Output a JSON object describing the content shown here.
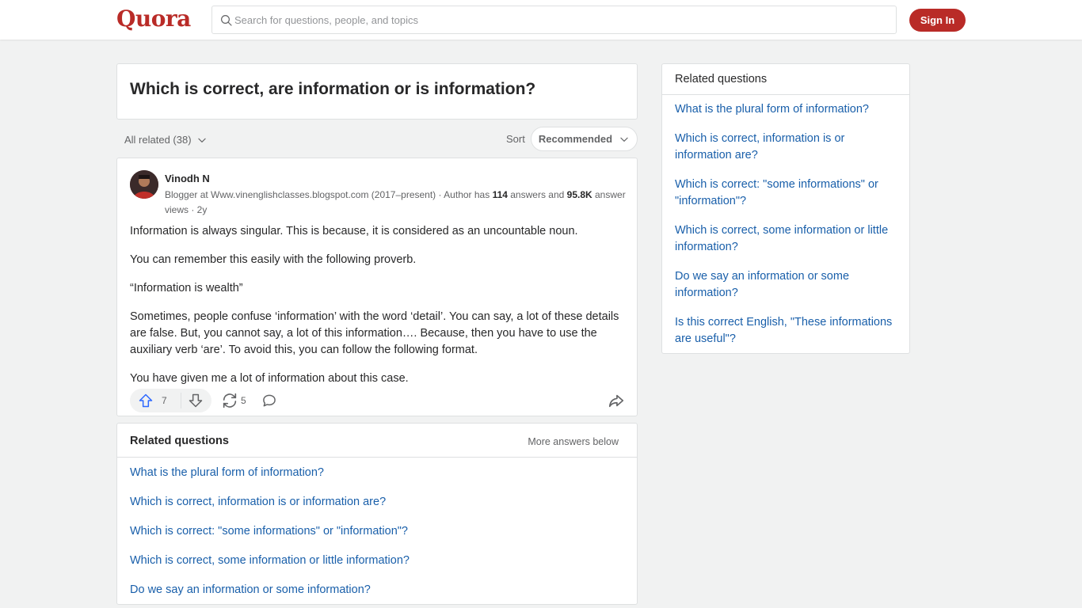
{
  "header": {
    "logo": "Quora",
    "search_placeholder": "Search for questions, people, and topics",
    "signin_label": "Sign In"
  },
  "question": {
    "title": "Which is correct, are information or is information?"
  },
  "filters": {
    "all_related": "All related (38)",
    "sort_label": "Sort",
    "sort_value": "Recommended"
  },
  "answer": {
    "author": "Vinodh N",
    "credential_prefix": "Blogger at Www.vinenglishclasses.blogspot.com (2017–present) · Author has ",
    "answers_count": "114",
    "credential_mid": " answers and ",
    "views_count": "95.8K",
    "credential_suffix": " answer views · 2y",
    "paragraphs": [
      "Information is always singular. This is because, it is considered as an uncountable noun.",
      "You can remember this easily with the following proverb.",
      "“Information is wealth”",
      "Sometimes, people confuse ‘information’ with the word ‘detail’. You can say, a lot of these details are false. But, you cannot say, a lot of this information…. Because, then you have to use the auxiliary verb ‘are’. To avoid this, you can follow the following format.",
      "You have given me a lot of information about this case."
    ],
    "upvotes": "7",
    "shares": "5"
  },
  "related_main": {
    "title": "Related questions",
    "more_label": "More answers below",
    "items": [
      "What is the plural form of information?",
      "Which is correct, information is or information are?",
      "Which is correct: \"some informations\" or \"information\"?",
      "Which is correct, some information or little information?",
      "Do we say an information or some information?"
    ]
  },
  "related_side": {
    "title": "Related questions",
    "items": [
      "What is the plural form of information?",
      "Which is correct, information is or information are?",
      "Which is correct: \"some informations\" or \"information\"?",
      "Which is correct, some information or little information?",
      "Do we say an information or some information?",
      "Is this correct English, \"These informations are useful\"?"
    ]
  },
  "colors": {
    "brand": "#b92b27",
    "link": "#195faa",
    "upvote": "#2e69ff"
  },
  "icons": {
    "search": "search-icon",
    "chevron": "chevron-down-icon",
    "upvote": "upvote-arrow-icon",
    "downvote": "downvote-arrow-icon",
    "share": "share-cycle-icon",
    "comment": "comment-bubble-icon",
    "forward": "forward-share-icon"
  }
}
